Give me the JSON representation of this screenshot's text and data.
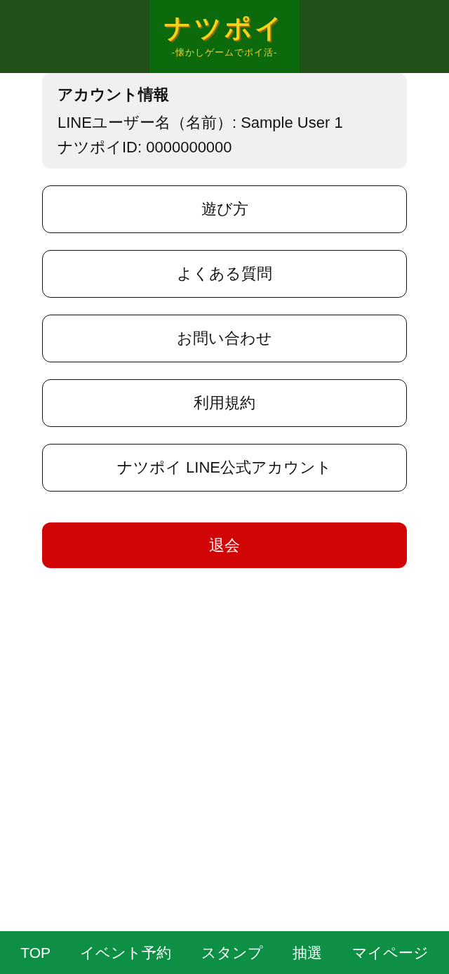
{
  "header": {
    "logo_title": "ナツポイ",
    "logo_tagline": "-懐かしゲームでポイ活-"
  },
  "account": {
    "title": "アカウント情報",
    "lines": [
      "LINEユーザー名（名前）: Sample User 1",
      "ナツポイID: 0000000000"
    ]
  },
  "menu": [
    {
      "label": "遊び方",
      "kind": "link"
    },
    {
      "label": "よくある質問",
      "kind": "link"
    },
    {
      "label": "お問い合わせ",
      "kind": "link"
    },
    {
      "label": "利用規約",
      "kind": "link"
    },
    {
      "label": "ナツポイ LINE公式アカウント",
      "kind": "link"
    },
    {
      "label": "退会",
      "kind": "danger"
    }
  ],
  "bottom_nav": [
    "TOP",
    "イベント予約",
    "スタンプ",
    "抽選",
    "マイページ"
  ]
}
